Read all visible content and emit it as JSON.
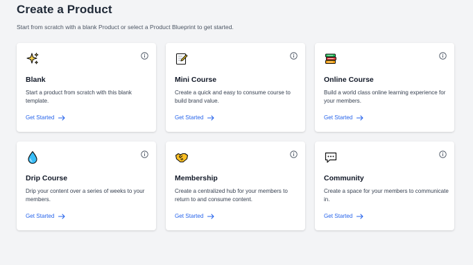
{
  "header": {
    "title": "Create a Product",
    "subtitle": "Start from scratch with a blank Product or select a Product Blueprint to get started."
  },
  "cards": [
    {
      "title": "Blank",
      "description": "Start a product from scratch with this blank template.",
      "link": "Get Started",
      "icon": "sparkles-icon"
    },
    {
      "title": "Mini Course",
      "description": "Create a quick and easy to consume course to build brand value.",
      "link": "Get Started",
      "icon": "memo-icon"
    },
    {
      "title": "Online Course",
      "description": "Build a world class online learning experience for your members.",
      "link": "Get Started",
      "icon": "books-icon"
    },
    {
      "title": "Drip Course",
      "description": "Drip your content over a series of weeks to your members.",
      "link": "Get Started",
      "icon": "droplet-icon"
    },
    {
      "title": "Membership",
      "description": "Create a centralized hub for your members to return to and consume content.",
      "link": "Get Started",
      "icon": "handshake-icon"
    },
    {
      "title": "Community",
      "description": "Create a space for your members to communicate in.",
      "link": "Get Started",
      "icon": "speech-bubble-icon"
    }
  ],
  "colors": {
    "link": "#2563eb",
    "background": "#f3f4f6",
    "card": "#ffffff"
  }
}
